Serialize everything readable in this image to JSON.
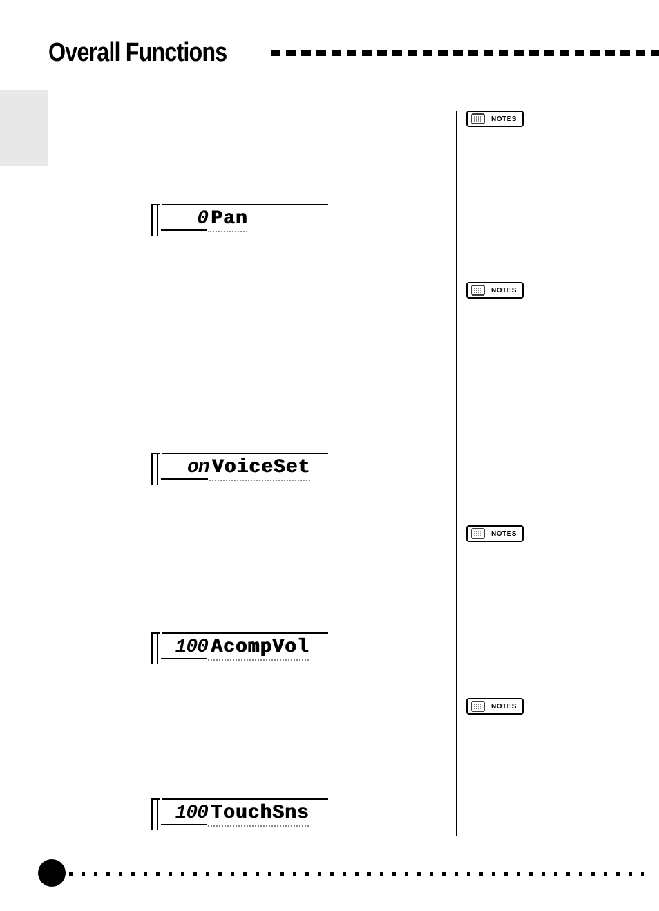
{
  "header": {
    "title": "Overall Functions"
  },
  "displays": [
    {
      "value": "0",
      "label": "Pan",
      "shortValue": true
    },
    {
      "value": "on",
      "label": "VoiceSet",
      "shortValue": true
    },
    {
      "value": "100",
      "label": "AcompVol",
      "shortValue": false
    },
    {
      "value": "100",
      "label": "TouchSns",
      "shortValue": false
    }
  ],
  "notes": {
    "label": "NOTES"
  }
}
